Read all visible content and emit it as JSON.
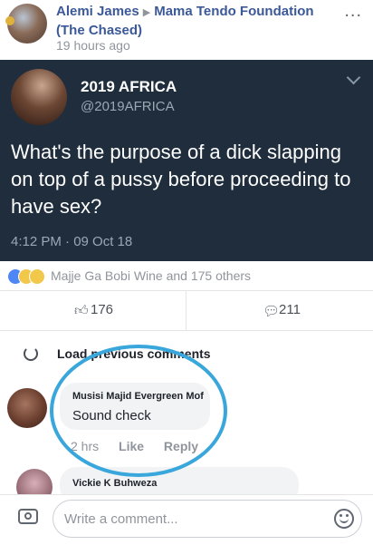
{
  "post": {
    "author": "Alemi James",
    "target": "Mama Tendo Foundation (The Chased)",
    "time": "19 hours ago",
    "more": "..."
  },
  "tweet": {
    "name": "2019 AFRICA",
    "handle": "@2019AFRICA",
    "text": "What's the purpose of a dick slapping on top of a pussy before proceeding to have sex?",
    "time": "4:12 PM · 09 Oct 18"
  },
  "reactions": {
    "text": "Majje Ga Bobi Wine and 175 others",
    "like_count": "176",
    "comment_count": "211"
  },
  "comments": {
    "load_previous": "Load previous comments",
    "items": [
      {
        "name": "Musisi Majid Evergreen Mof",
        "text": "Sound check",
        "time": "2 hrs",
        "like": "Like",
        "reply": "Reply"
      },
      {
        "name": "Vickie K Buhweza"
      }
    ]
  },
  "composer": {
    "placeholder": "Write a comment..."
  },
  "icons": {
    "reactions": [
      "like-icon",
      "haha-icon",
      "wow-icon"
    ],
    "actions": [
      "thumbs-up-icon",
      "speech-bubble-icon"
    ],
    "composer": [
      "camera-icon",
      "emoji-icon"
    ]
  },
  "colors": {
    "link": "#3b5998",
    "tweet_background": "#1f2d3d",
    "annotation": "#3aa7dc"
  }
}
